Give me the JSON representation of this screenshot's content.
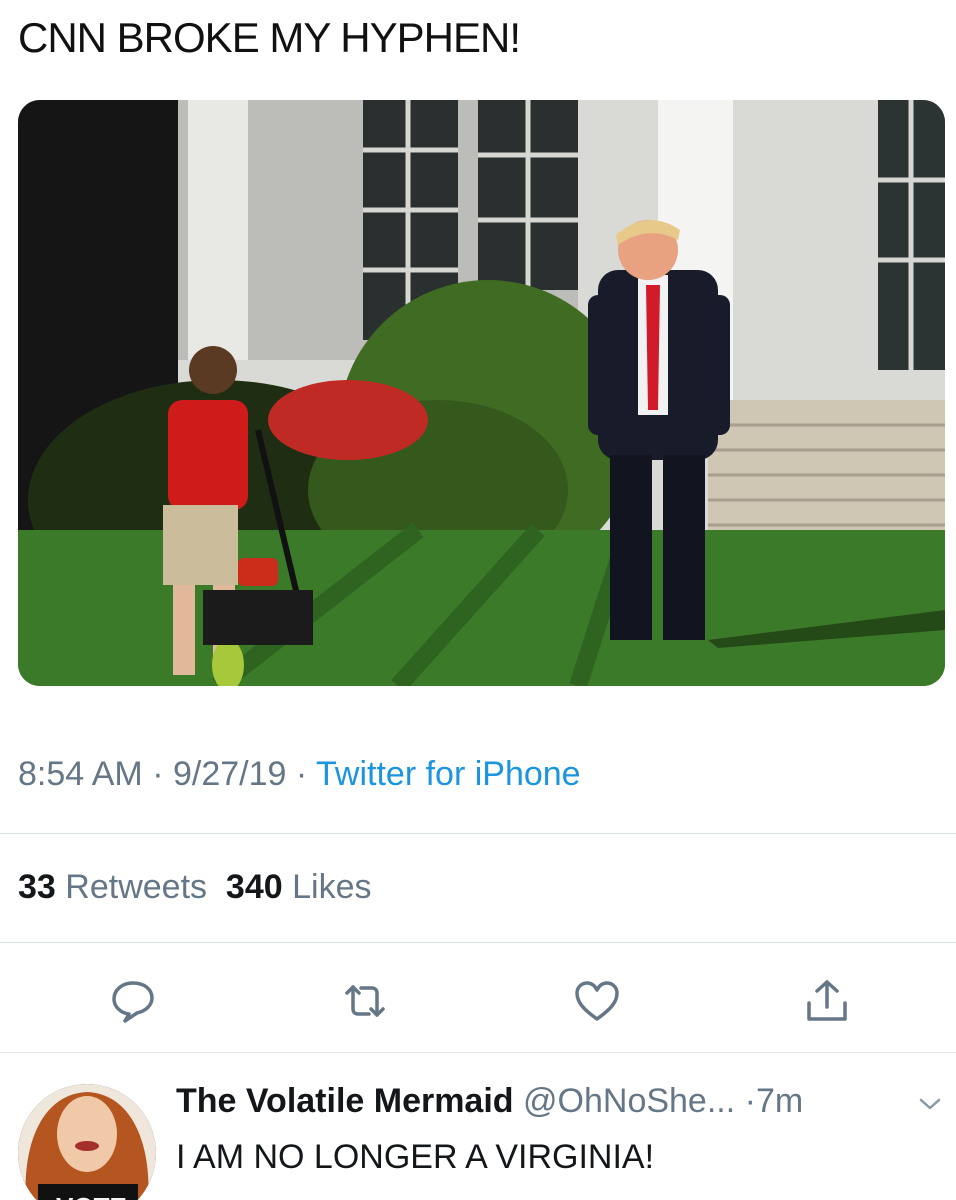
{
  "tweet": {
    "text": "CNN BROKE MY HYPHEN!",
    "time": "8:54 AM",
    "date": "9/27/19",
    "source": "Twitter for iPhone",
    "separator": " · "
  },
  "stats": {
    "retweets_count": "33",
    "retweets_label": "Retweets",
    "likes_count": "340",
    "likes_label": "Likes"
  },
  "actions": {
    "icons": [
      "reply-icon",
      "retweet-icon",
      "like-icon",
      "share-icon"
    ]
  },
  "reply": {
    "display_name": "The Volatile Mermaid",
    "handle": "@OhNoShe...",
    "time": "·7m",
    "text": "I AM NO LONGER A VIRGINIA!",
    "avatar_text": "VOTE"
  },
  "colors": {
    "accent": "#1b95e0",
    "muted": "#657786",
    "divider": "#e1e8ed"
  }
}
